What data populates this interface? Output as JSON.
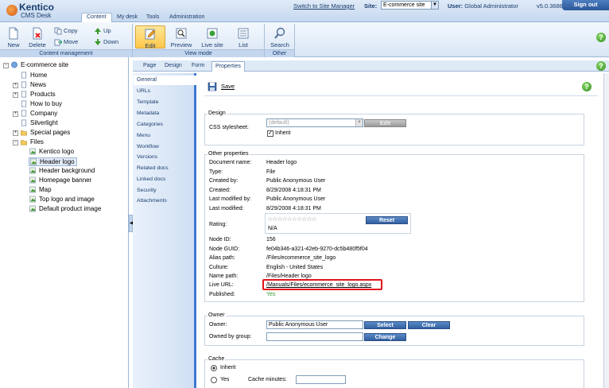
{
  "header": {
    "logo_brand": "Kentico",
    "logo_product": "CMS Desk",
    "tabs": [
      "Content",
      "My desk",
      "Tools",
      "Administration"
    ],
    "switch_link": "Switch to Site Manager",
    "site_label": "Site:",
    "site_value": "E-commerce site",
    "user_label": "User:",
    "user_value": "Global Administrator",
    "version": "v5.0.3688",
    "signout": "Sign out"
  },
  "toolbar": {
    "content_management": {
      "caption": "Content management",
      "new": "New",
      "delete": "Delete",
      "copy": "Copy",
      "move": "Move",
      "up": "Up",
      "down": "Down"
    },
    "view_mode": {
      "caption": "View mode",
      "edit": "Edit",
      "preview": "Preview",
      "live_site": "Live site",
      "list": "List"
    },
    "other": {
      "caption": "Other",
      "search": "Search"
    }
  },
  "tree": {
    "root": "E-commerce site",
    "items": [
      "Home",
      "News",
      "Products",
      "How to buy",
      "Company",
      "Silverlight",
      "Special pages",
      "Files"
    ],
    "files_children": [
      "Kentico logo",
      "Header logo",
      "Header background",
      "Homepage banner",
      "Map",
      "Top logo and image",
      "Default product image"
    ],
    "selected": "Header logo"
  },
  "subtabs": [
    "Page",
    "Design",
    "Form",
    "Properties"
  ],
  "active_subtab": "Properties",
  "left_nav": [
    "General",
    "URLs",
    "Template",
    "Metadata",
    "Categories",
    "Menu",
    "Workflow",
    "Versions",
    "Related docs",
    "Linked docs",
    "Security",
    "Attachments"
  ],
  "active_left_nav": "General",
  "save_label": "Save",
  "design": {
    "legend": "Design",
    "css_label": "CSS stylesheet:",
    "css_value": "(default)",
    "edit_button": "Edit",
    "inherit_label": "Inherit",
    "inherit_checked": true
  },
  "other_properties": {
    "legend": "Other properties",
    "rows": [
      {
        "label": "Document name:",
        "value": "Header logo"
      },
      {
        "label": "Type:",
        "value": "File"
      },
      {
        "label": "Created by:",
        "value": "Public Anonymous User"
      },
      {
        "label": "Created:",
        "value": "8/29/2008 4:18:31 PM"
      },
      {
        "label": "Last modified by:",
        "value": "Public Anonymous User"
      },
      {
        "label": "Last modified:",
        "value": "8/29/2008 4:18:31 PM"
      }
    ],
    "rating_label": "Rating:",
    "rating_value": "N/A",
    "rating_stars": "☆☆☆☆☆☆☆☆☆☆",
    "reset_button": "Reset",
    "rows2": [
      {
        "label": "Node ID:",
        "value": "156"
      },
      {
        "label": "Node GUID:",
        "value": "fe04b346-a321-42eb-9270-dc5b480f5f04"
      },
      {
        "label": "Alias path:",
        "value": "/Files/ecommerce_site_logo"
      },
      {
        "label": "Culture:",
        "value": "English - United States"
      },
      {
        "label": "Name path:",
        "value": "/Files/Header logo"
      }
    ],
    "live_url_label": "Live URL:",
    "live_url_value": "/Manuals/Files/ecommerce_site_logo.aspx",
    "published_label": "Published:",
    "published_value": "Yes"
  },
  "owner": {
    "legend": "Owner",
    "owner_label": "Owner:",
    "owner_value": "Public Anonymous User",
    "select_button": "Select",
    "clear_button": "Clear",
    "group_label": "Owned by group:",
    "group_value": "",
    "change_button": "Change"
  },
  "cache": {
    "legend": "Cache",
    "inherit_option": "Inherit",
    "yes_option": "Yes",
    "minutes_label": "Cache minutes:",
    "minutes_value": ""
  },
  "colors": {
    "accent": "#3c7bd2",
    "highlight": "#e0151b",
    "published": "#2e9a2e"
  }
}
